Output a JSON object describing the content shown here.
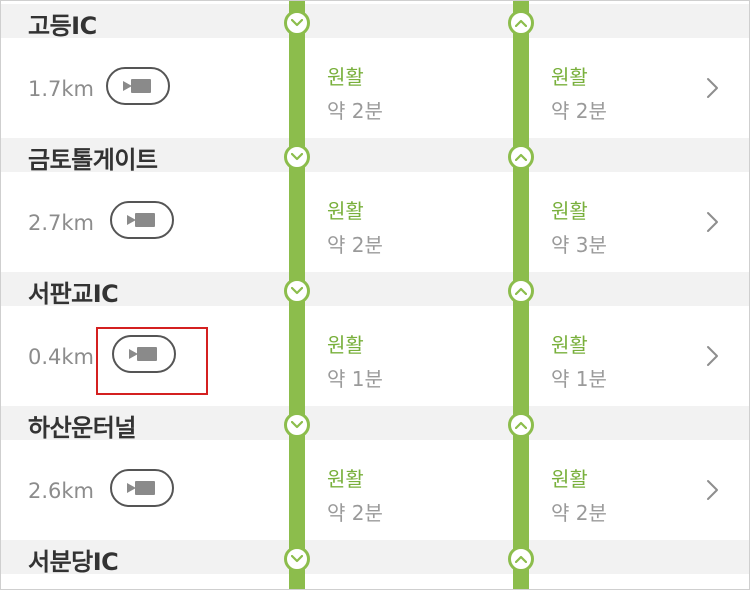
{
  "colors": {
    "rail": "#8cbd4c",
    "status_text": "#79b03c",
    "highlight": "#d42020"
  },
  "icons": {
    "camera": "cctv-camera-icon",
    "down": "down-arrow-icon",
    "up": "up-arrow-icon",
    "chevron": "chevron-right-icon"
  },
  "sections": [
    {
      "name": "고등IC",
      "distance": "1.7km",
      "down": {
        "status": "원활",
        "time": "약 2분"
      },
      "up": {
        "status": "원활",
        "time": "약 2분"
      }
    },
    {
      "name": "금토톨게이트",
      "distance": "2.7km",
      "down": {
        "status": "원활",
        "time": "약 2분"
      },
      "up": {
        "status": "원활",
        "time": "약 3분"
      }
    },
    {
      "name": "서판교IC",
      "distance": "0.4km",
      "down": {
        "status": "원활",
        "time": "약 1분"
      },
      "up": {
        "status": "원활",
        "time": "약 1분"
      }
    },
    {
      "name": "하산운터널",
      "distance": "2.6km",
      "down": {
        "status": "원활",
        "time": "약 2분"
      },
      "up": {
        "status": "원활",
        "time": "약 2분"
      }
    },
    {
      "name": "서분당IC"
    }
  ]
}
